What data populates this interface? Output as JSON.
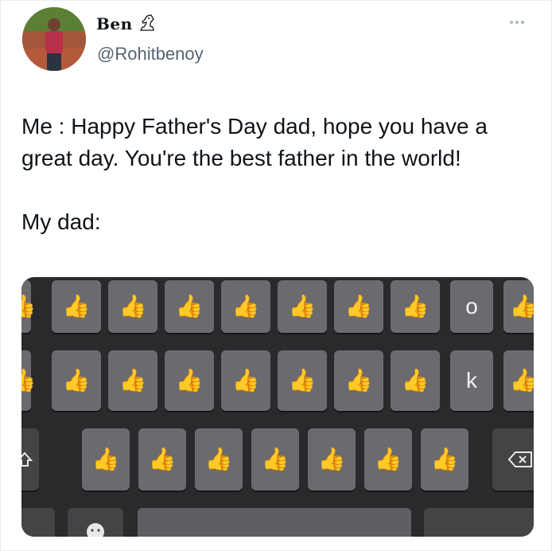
{
  "author": {
    "display_name": "Ben",
    "handle": "@Rohitbenoy",
    "badge_icon": "knight-chess-icon"
  },
  "more_menu_icon": "ellipsis-icon",
  "tweet": {
    "line1": "Me : Happy Father's Day dad, hope you have a",
    "line2": "great day. You're the best father in the world!",
    "line3": "My dad:"
  },
  "keyboard": {
    "thumb": "👍",
    "row1_letter": "o",
    "row2_letter": "k",
    "icons": [
      "shift-icon",
      "backspace-icon",
      "emoji-face-icon"
    ]
  },
  "colors": {
    "text": "#0f1419",
    "secondary_text": "#536471",
    "keyboard_bg": "#2a2a2c",
    "key_bg": "#6b6b6f"
  }
}
